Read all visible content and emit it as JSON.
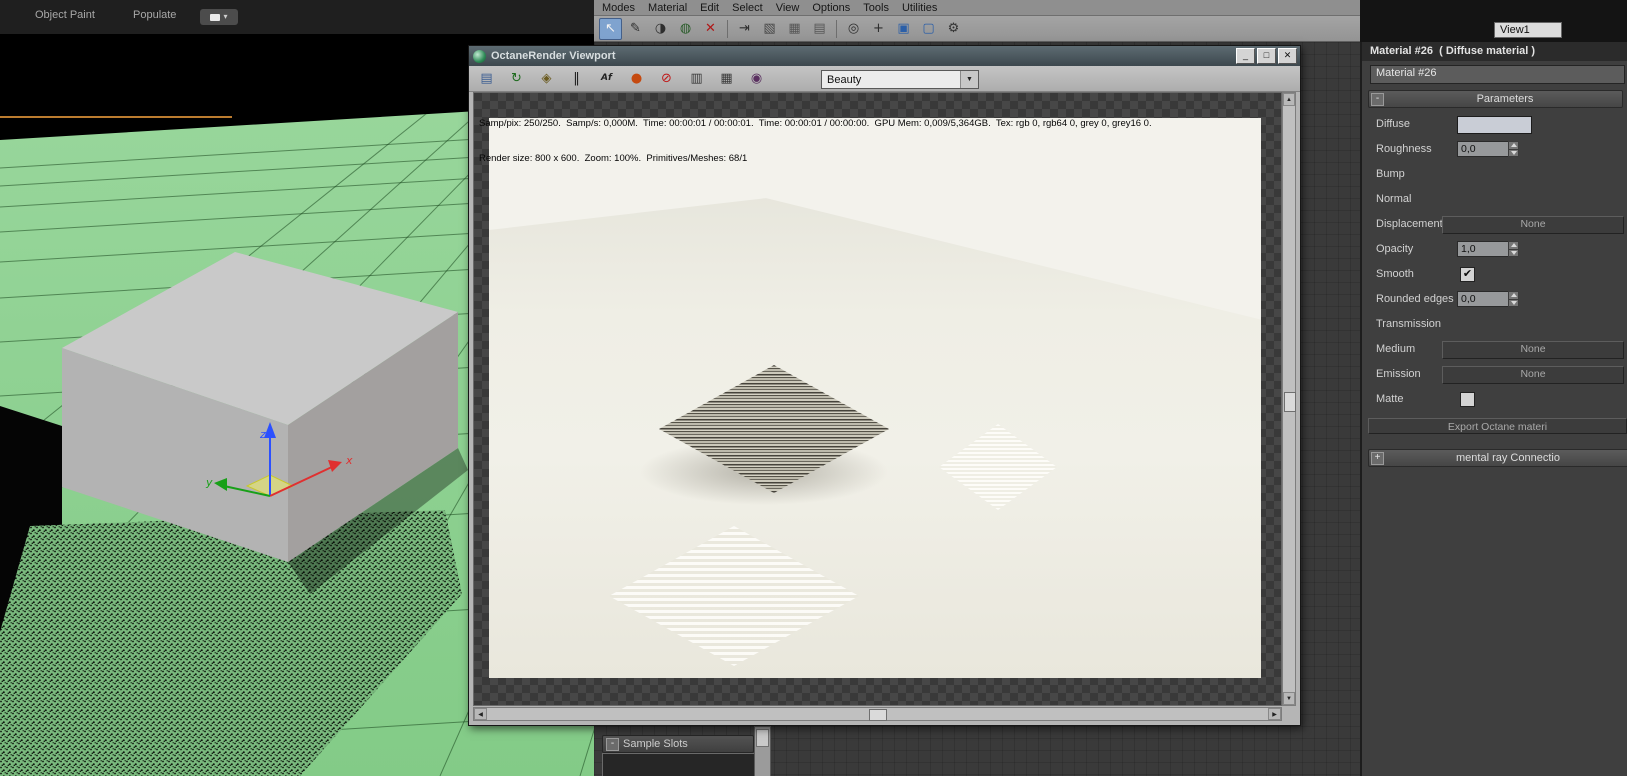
{
  "colors": {
    "viewport_green": "#8fd092",
    "render_background": "#f3f2ec",
    "panel_background": "#3f3f3f",
    "accent_blue": "#7fa3cf",
    "diffuse_swatch": "#c9cdd6"
  },
  "glyphs": {
    "collapse": "-",
    "expand": "+",
    "dropdown_arrow": "▼",
    "small_arrow": "▾",
    "check": "✔",
    "scroll_up": "▲",
    "scroll_down": "▼",
    "scroll_left": "◀",
    "scroll_right": "▶",
    "window_minimize": "_",
    "window_maximize": "□",
    "window_close": "✕"
  },
  "ribbon": {
    "tabs": [
      {
        "label": "Object Paint"
      },
      {
        "label": "Populate"
      }
    ]
  },
  "viewport": {
    "axis_x": "x",
    "axis_y": "y",
    "axis_z": "z"
  },
  "material_editor": {
    "menus": [
      "Modes",
      "Material",
      "Edit",
      "Select",
      "View",
      "Options",
      "Tools",
      "Utilities"
    ],
    "toolbar_icons": [
      {
        "name": "select-tool-icon",
        "glyph": "↖",
        "color": "#f4f4f4",
        "active": true
      },
      {
        "name": "pick-material-from-object-icon",
        "glyph": "✎",
        "color": "#2e2e2e"
      },
      {
        "name": "make-material-copy-icon",
        "glyph": "◑",
        "color": "#2e2e2e"
      },
      {
        "name": "assign-material-to-selection-icon",
        "glyph": "◍",
        "color": "#2a5c2a"
      },
      {
        "name": "delete-selected-icon",
        "glyph": "✕",
        "color": "#b01818"
      },
      {
        "sep": true
      },
      {
        "name": "move-children-icon",
        "glyph": "⇥",
        "color": "#2e2e2e"
      },
      {
        "name": "hide-unused-nodeslots-icon",
        "glyph": "▧",
        "color": "#474747"
      },
      {
        "name": "show-background-icon",
        "glyph": "▦",
        "color": "#565656"
      },
      {
        "name": "show-grid-icon",
        "glyph": "▤",
        "color": "#565656"
      },
      {
        "sep": true
      },
      {
        "name": "zoom-tool-icon",
        "glyph": "◎",
        "color": "#2e2e2e"
      },
      {
        "name": "pan-tool-icon",
        "glyph": "+",
        "color": "#2e2e2e"
      },
      {
        "name": "layout-all-icon",
        "glyph": "▣",
        "color": "#2b5fa8"
      },
      {
        "name": "zoom-extents-icon",
        "glyph": "▢",
        "color": "#2b5fa8"
      },
      {
        "name": "material-settings-icon",
        "glyph": "⚙",
        "color": "#333333"
      }
    ],
    "sample_slots_label": "Sample Slots",
    "view_selector": "View1"
  },
  "octane": {
    "title": "OctaneRender Viewport",
    "render_mode": "Beauty",
    "stats_line1": "Samp/pix: 250/250.  Samp/s: 0,000M.  Time: 00:00:01 / 00:00:01.  Time: 00:00:01 / 00:00:00.  GPU Mem: 0,009/5,364GB.  Tex: rgb 0, rgb64 0, grey 0, grey16 0.",
    "stats_line2": "Render size: 800 x 600.  Zoom: 100%.  Primitives/Meshes: 68/1",
    "toolbar_icons": [
      {
        "name": "save-render-icon",
        "glyph": "▤",
        "color": "#3c5e92"
      },
      {
        "name": "restart-render-icon",
        "glyph": "↻",
        "color": "#1f6b1f"
      },
      {
        "name": "lock-resolution-icon",
        "glyph": "◈",
        "color": "#6b5b20"
      },
      {
        "name": "pause-render-icon",
        "glyph": "‖",
        "color": "#222222"
      },
      {
        "name": "text-overlay-icon",
        "glyph": "Af",
        "color": "#222222",
        "wide": true
      },
      {
        "name": "render-region-icon",
        "glyph": "●",
        "color": "#c54a10"
      },
      {
        "name": "stop-render-icon",
        "glyph": "⊘",
        "color": "#c01818"
      },
      {
        "name": "viewport-lock-icon",
        "glyph": "▥",
        "color": "#3a3a3a"
      },
      {
        "name": "picture-viewer-icon",
        "glyph": "▦",
        "color": "#3a3a3a"
      },
      {
        "name": "camera-settings-icon",
        "glyph": "◉",
        "color": "#5a3060"
      }
    ]
  },
  "right_panel": {
    "header": "Material #26  ( Diffuse material )",
    "material_name": "Material #26",
    "rollouts": {
      "parameters": "Parameters",
      "mental_ray": "mental ray Connectio",
      "export_button": "Export Octane materi"
    },
    "rows": [
      {
        "label": "Diffuse",
        "control": "swatch",
        "value": "#c9cdd6"
      },
      {
        "label": "Roughness",
        "control": "spinner",
        "value": "0,0"
      },
      {
        "label": "Bump",
        "control": "none"
      },
      {
        "label": "Normal",
        "control": "none"
      },
      {
        "label": "Displacement",
        "control": "button",
        "value": "None"
      },
      {
        "label": "Opacity",
        "control": "spinner",
        "value": "1,0"
      },
      {
        "label": "Smooth",
        "control": "checkbox",
        "checked": true
      },
      {
        "label": "Rounded edges",
        "control": "spinner",
        "value": "0,0"
      },
      {
        "label": "Transmission",
        "control": "none"
      },
      {
        "label": "Medium",
        "control": "button",
        "value": "None"
      },
      {
        "label": "Emission",
        "control": "button",
        "value": "None"
      },
      {
        "label": "Matte",
        "control": "checkbox",
        "checked": false
      }
    ]
  }
}
